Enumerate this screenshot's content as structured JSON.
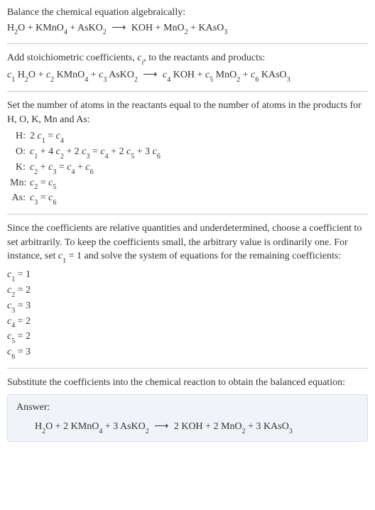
{
  "s1": {
    "intro": "Balance the chemical equation algebraically:",
    "reactants": [
      {
        "formula": "H",
        "sub": "2",
        "tail": "O"
      },
      {
        "formula": "KMnO",
        "sub": "4"
      },
      {
        "formula": "AsKO",
        "sub": "2"
      }
    ],
    "products": [
      {
        "formula": "KOH"
      },
      {
        "formula": "MnO",
        "sub": "2"
      },
      {
        "formula": "KAsO",
        "sub": "3"
      }
    ],
    "arrow": "⟶"
  },
  "s2": {
    "intro_a": "Add stoichiometric coefficients, ",
    "ci": "c",
    "ci_sub": "i",
    "intro_b": ", to the reactants and products:",
    "terms_left": [
      {
        "c": "c",
        "ci": "1",
        "sp": " H",
        "sub": "2",
        "tail": "O"
      },
      {
        "c": "c",
        "ci": "2",
        "sp": " KMnO",
        "sub": "4"
      },
      {
        "c": "c",
        "ci": "3",
        "sp": " AsKO",
        "sub": "2"
      }
    ],
    "terms_right": [
      {
        "c": "c",
        "ci": "4",
        "sp": " KOH"
      },
      {
        "c": "c",
        "ci": "5",
        "sp": " MnO",
        "sub": "2"
      },
      {
        "c": "c",
        "ci": "6",
        "sp": " KAsO",
        "sub": "3"
      }
    ],
    "arrow": "⟶",
    "plus": " + "
  },
  "s3": {
    "intro": "Set the number of atoms in the reactants equal to the number of atoms in the products for H, O, K, Mn and As:",
    "rows": [
      {
        "el": "H:",
        "eq_parts": [
          "2 ",
          "c",
          "1",
          " = ",
          "c",
          "4"
        ]
      },
      {
        "el": "O:",
        "eq_parts": [
          "",
          "c",
          "1",
          " + 4 ",
          "c",
          "2",
          " + 2 ",
          "c",
          "3",
          " = ",
          "c",
          "4",
          " + 2 ",
          "c",
          "5",
          " + 3 ",
          "c",
          "6"
        ]
      },
      {
        "el": "K:",
        "eq_parts": [
          "",
          "c",
          "2",
          " + ",
          "c",
          "3",
          " = ",
          "c",
          "4",
          " + ",
          "c",
          "6"
        ]
      },
      {
        "el": "Mn:",
        "eq_parts": [
          "",
          "c",
          "2",
          " = ",
          "c",
          "5"
        ]
      },
      {
        "el": "As:",
        "eq_parts": [
          "",
          "c",
          "3",
          " = ",
          "c",
          "6"
        ]
      }
    ]
  },
  "s4": {
    "intro_a": "Since the coefficients are relative quantities and underdetermined, choose a coefficient to set arbitrarily. To keep the coefficients small, the arbitrary value is ordinarily one. For instance, set ",
    "c": "c",
    "c1": "1",
    "eq1": " = 1",
    "intro_b": " and solve the system of equations for the remaining coefficients:",
    "coeffs": [
      {
        "c": "c",
        "i": "1",
        "v": " = 1"
      },
      {
        "c": "c",
        "i": "2",
        "v": " = 2"
      },
      {
        "c": "c",
        "i": "3",
        "v": " = 3"
      },
      {
        "c": "c",
        "i": "4",
        "v": " = 2"
      },
      {
        "c": "c",
        "i": "5",
        "v": " = 2"
      },
      {
        "c": "c",
        "i": "6",
        "v": " = 3"
      }
    ]
  },
  "s5": {
    "intro": "Substitute the coefficients into the chemical reaction to obtain the balanced equation:"
  },
  "answer": {
    "label": "Answer:",
    "terms_left": [
      {
        "n": "",
        "f": "H",
        "sub": "2",
        "tail": "O"
      },
      {
        "n": "2 ",
        "f": "KMnO",
        "sub": "4"
      },
      {
        "n": "3 ",
        "f": "AsKO",
        "sub": "2"
      }
    ],
    "terms_right": [
      {
        "n": "2 ",
        "f": "KOH"
      },
      {
        "n": "2 ",
        "f": "MnO",
        "sub": "2"
      },
      {
        "n": "3 ",
        "f": "KAsO",
        "sub": "3"
      }
    ],
    "arrow": "⟶",
    "plus": " + "
  }
}
